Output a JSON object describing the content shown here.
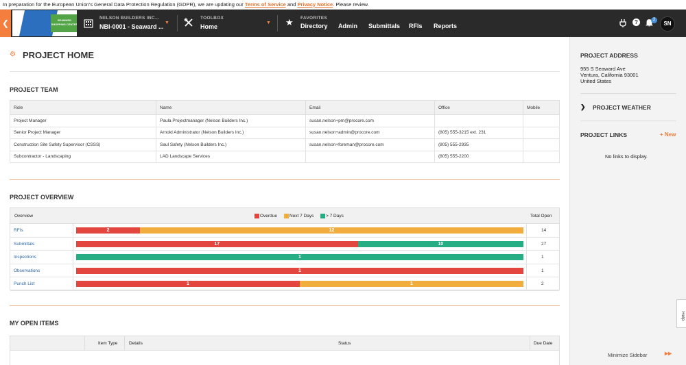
{
  "gdpr": {
    "prefix": "In preparation for the European Union's General Data Protection Regulation (GDPR), we are updating our ",
    "tos": "Terms of Service",
    "and": " and ",
    "privacy": "Privacy Notice",
    "suffix": ". Please review."
  },
  "nav": {
    "logo_text": "SEAWARD SHOPPING CENTER",
    "company_label": "NELSON BUILDERS INC...",
    "project": "NBI-0001 - Seaward ...",
    "toolbox_label": "TOOLBOX",
    "toolbox_value": "Home",
    "favorites_label": "FAVORITES",
    "links": [
      "Directory",
      "Admin",
      "Submittals",
      "RFIs",
      "Reports"
    ],
    "notification_count": "2",
    "avatar_initials": "SN"
  },
  "page": {
    "title": "PROJECT HOME",
    "team_title": "PROJECT TEAM",
    "overview_title": "PROJECT OVERVIEW",
    "open_items_title": "MY OPEN ITEMS"
  },
  "team": {
    "columns": [
      "Role",
      "Name",
      "Email",
      "Office",
      "Mobile"
    ],
    "rows": [
      [
        "Project Manager",
        "Paula Projectmanager (Nelson Builders Inc.)",
        "susan.nelson+pm@procore.com",
        "",
        ""
      ],
      [
        "Senior Project Manager",
        "Arnold Administrator (Nelson Builders Inc.)",
        "susan.nelson+admin@procore.com",
        "(805) 555-3215 ext. 231",
        ""
      ],
      [
        "Construction Site Safety Supervisor (CSSS)",
        "Saul Safety (Nelson Builders Inc.)",
        "susan.nelson+foreman@procore.com",
        "(805) 555-2935",
        ""
      ],
      [
        "Subcontractor - Landscaping",
        "LAD Landscape Services",
        "",
        "(805) 555-2200",
        ""
      ]
    ]
  },
  "overview": {
    "col_overview": "Overview",
    "col_total": "Total Open",
    "legend": {
      "overdue": "Overdue",
      "next7": "Next 7 Days",
      "gt7": "> 7 Days"
    },
    "colors": {
      "overdue": "#e2463f",
      "next7": "#f1ad3d",
      "gt7": "#25ad83"
    },
    "rows": [
      {
        "name": "RFIs",
        "overdue": 2,
        "next7": 12,
        "gt7": 0,
        "total": "14",
        "l_overdue": "2",
        "l_next7": "12",
        "l_gt7": ""
      },
      {
        "name": "Submittals",
        "overdue": 17,
        "next7": 0,
        "gt7": 10,
        "total": "27",
        "l_overdue": "17",
        "l_next7": "",
        "l_gt7": "10"
      },
      {
        "name": "Inspections",
        "overdue": 0,
        "next7": 0,
        "gt7": 1,
        "total": "1",
        "l_overdue": "",
        "l_next7": "",
        "l_gt7": "1"
      },
      {
        "name": "Observations",
        "overdue": 1,
        "next7": 0,
        "gt7": 0,
        "total": "1",
        "l_overdue": "1",
        "l_next7": "",
        "l_gt7": ""
      },
      {
        "name": "Punch List",
        "overdue": 1,
        "next7": 1,
        "gt7": 0,
        "total": "2",
        "l_overdue": "1",
        "l_next7": "1",
        "l_gt7": ""
      }
    ]
  },
  "open_items": {
    "columns": [
      "Item Type",
      "Details",
      "Status",
      "Due Date"
    ]
  },
  "sidebar": {
    "address_title": "PROJECT ADDRESS",
    "address_lines": [
      "955 S Seaward Ave",
      "Ventura, California 93001",
      "United States"
    ],
    "weather_title": "PROJECT WEATHER",
    "links_title": "PROJECT LINKS",
    "new_label": "+ New",
    "no_links": "No links to display.",
    "minimize": "Minimize Sidebar",
    "help": "Help"
  }
}
